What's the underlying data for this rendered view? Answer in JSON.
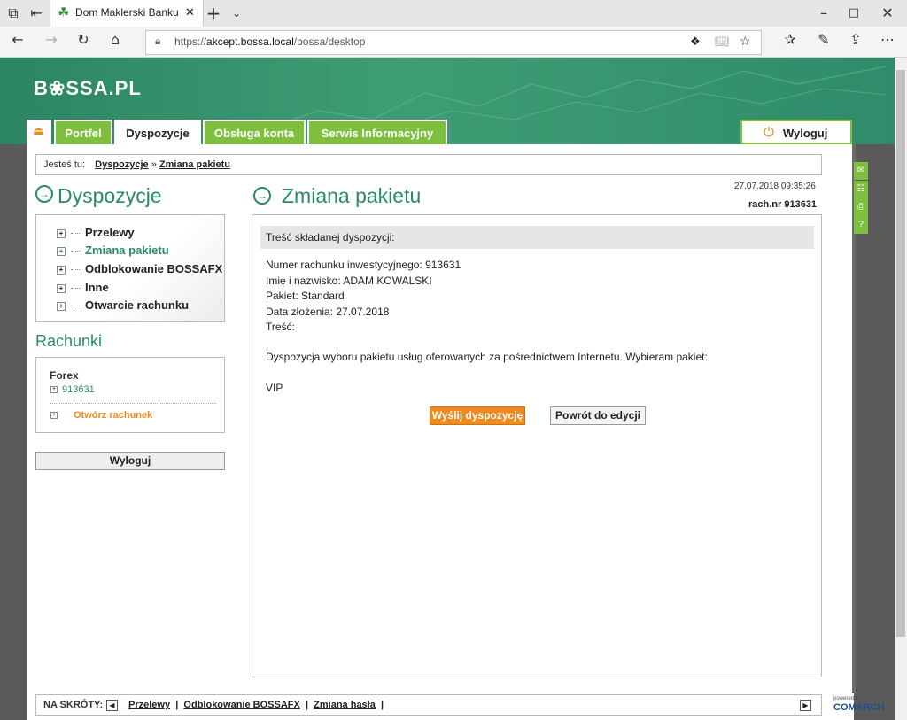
{
  "browser": {
    "tab_title": "Dom Maklerski Banku C",
    "url_prefix": "https://",
    "url_host": "akcept.bossa.local",
    "url_path": "/bossa/desktop"
  },
  "header": {
    "logo": "B❀SSA.PL",
    "nav": [
      "Portfel",
      "Dyspozycje",
      "Obsługa konta",
      "Serwis Informacyjny"
    ],
    "logout": "Wyloguj"
  },
  "breadcrumb": {
    "prefix": "Jesteś tu:",
    "item1": "Dyspozycje",
    "sep": "»",
    "item2": "Zmiana pakietu"
  },
  "sidebar": {
    "title": "Dyspozycje",
    "menu": [
      "Przelewy",
      "Zmiana pakietu",
      "Odblokowanie BOSSAFX",
      "Inne",
      "Otwarcie rachunku"
    ],
    "accounts_title": "Rachunki",
    "account_group": "Forex",
    "account_number": "913631",
    "open_account": "Otwórz rachunek",
    "logout": "Wyloguj"
  },
  "main": {
    "title": "Zmiana pakietu",
    "datetime": "27.07.2018 09:35:26",
    "account_label": "rach.nr 913631",
    "box_header": "Treść składanej dyspozycji:",
    "line1": "Numer rachunku inwestycyjnego: 913631",
    "line2": "Imię i nazwisko: ADAM KOWALSKI",
    "line3": "Pakiet: Standard",
    "line4": "Data złożenia: 27.07.2018",
    "line5": "Treść:",
    "paragraph": "Dyspozycja wyboru pakietu usług oferowanych za pośrednictwem Internetu. Wybieram pakiet:",
    "package": "VIP",
    "send_button": "Wyślij dyspozycję",
    "back_button": "Powrót do edycji"
  },
  "footer": {
    "label": "NA SKRÓTY:",
    "links": [
      "Przelewy",
      "Odblokowanie BOSSAFX",
      "Zmiana hasła"
    ],
    "powered": "powered by",
    "brand": "COMARCH"
  },
  "colors": {
    "brand_green": "#2f8b6a",
    "tab_green": "#7fbf3e",
    "accent_orange": "#ef8a1e",
    "title_green": "#2b8a66"
  }
}
